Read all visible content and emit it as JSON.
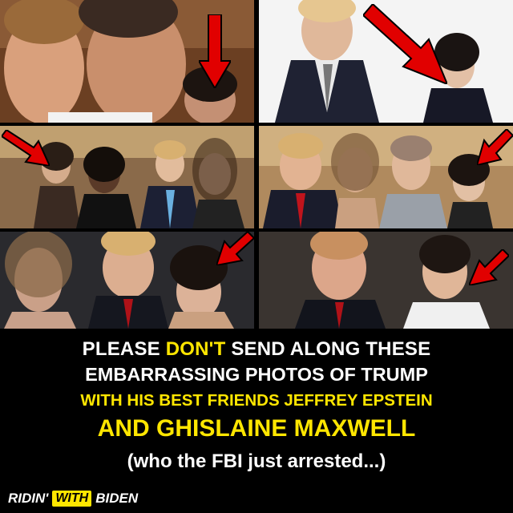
{
  "caption": {
    "line1_pre": "PLEASE ",
    "line1_highlight": "DON'T",
    "line1_post": " SEND ALONG THESE",
    "line2": "EMBARRASSING PHOTOS OF TRUMP",
    "line3": "WITH HIS BEST FRIENDS JEFFREY EPSTEIN",
    "line4": "AND GHISLAINE MAXWELL",
    "line5": "(who the FBI just arrested...)"
  },
  "brand": {
    "word1": "RIDIN'",
    "word2": "WITH",
    "word3": "BIDEN"
  },
  "colors": {
    "accent": "#ffe600",
    "arrow": "#e10000",
    "background": "#000000",
    "text": "#ffffff"
  },
  "photos": [
    {
      "id": "photo-1",
      "arrow": "red-arrow-icon"
    },
    {
      "id": "photo-2",
      "arrow": "red-arrow-icon"
    },
    {
      "id": "photo-3",
      "arrow": "red-arrow-icon"
    },
    {
      "id": "photo-4",
      "arrow": "red-arrow-icon"
    },
    {
      "id": "photo-5",
      "arrow": "red-arrow-icon"
    },
    {
      "id": "photo-6",
      "arrow": "red-arrow-icon"
    }
  ]
}
